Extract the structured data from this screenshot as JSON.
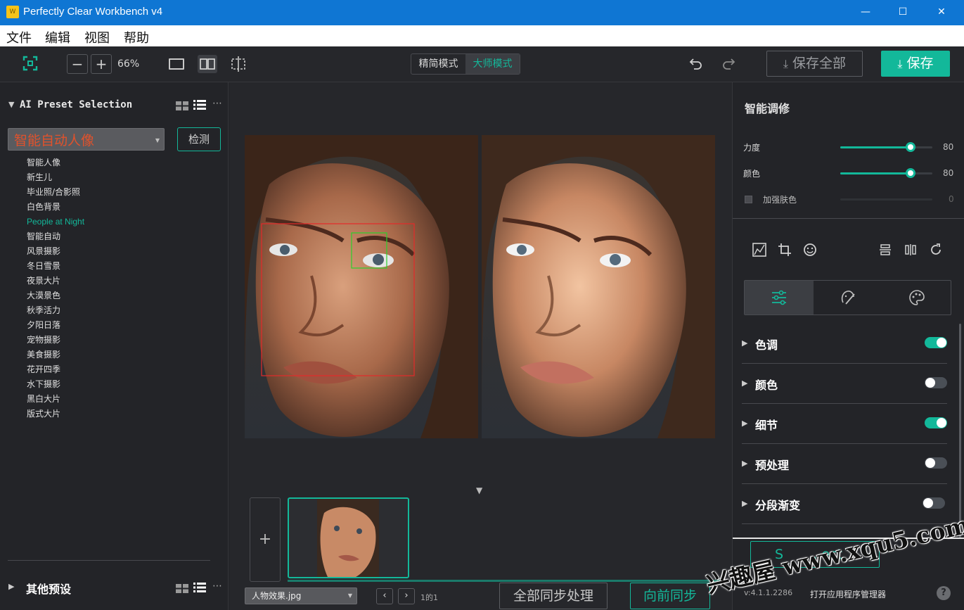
{
  "window": {
    "title": "Perfectly Clear Workbench v4",
    "logo_text": "W"
  },
  "menu": [
    "文件",
    "编辑",
    "视图",
    "帮助"
  ],
  "toolbar": {
    "zoom": "66%",
    "mode_simple": "精简模式",
    "mode_master": "大师模式",
    "save_all": "保存全部",
    "save": "保存"
  },
  "left": {
    "section_title": "AI Preset Selection",
    "selected_preset": "智能自动人像",
    "detect_button": "检测",
    "presets": [
      "智能人像",
      "新生儿",
      "毕业照/合影照",
      "白色背景",
      "People at Night",
      "智能自动",
      "风景摄影",
      "冬日雪景",
      "夜景大片",
      "大漠景色",
      "秋季活力",
      "夕阳日落",
      "宠物摄影",
      "美食摄影",
      "花开四季",
      "水下摄影",
      "黑白大片",
      "版式大片"
    ],
    "active_preset": "People at Night",
    "other_presets": "其他预设"
  },
  "center": {
    "file_name": "人物效果.jpg",
    "page_indicator": "1的1",
    "sync_all": "全部同步处理",
    "sync_forward": "向前同步",
    "add_symbol": "+"
  },
  "right": {
    "section_title": "智能调修",
    "sliders": [
      {
        "label": "力度",
        "value": 80,
        "value_text": "80",
        "enabled": true
      },
      {
        "label": "颜色",
        "value": 80,
        "value_text": "80",
        "enabled": true
      },
      {
        "label": "加强肤色",
        "value": 0,
        "value_text": "0",
        "enabled": false
      }
    ],
    "accordion": [
      {
        "label": "色调",
        "on": true
      },
      {
        "label": "颜色",
        "on": false
      },
      {
        "label": "细节",
        "on": true
      },
      {
        "label": "预处理",
        "on": false
      },
      {
        "label": "分段渐变",
        "on": false
      }
    ],
    "partial_button": "S      ...ect",
    "version": "v:4.1.1.2286",
    "app_manager": "打开应用程序管理器",
    "help": "?"
  },
  "watermark": "兴趣屋 www.xqu5.com",
  "colors": {
    "accent": "#13b89a",
    "titlebar": "#0f76d3",
    "preset_text": "#e0522c"
  }
}
